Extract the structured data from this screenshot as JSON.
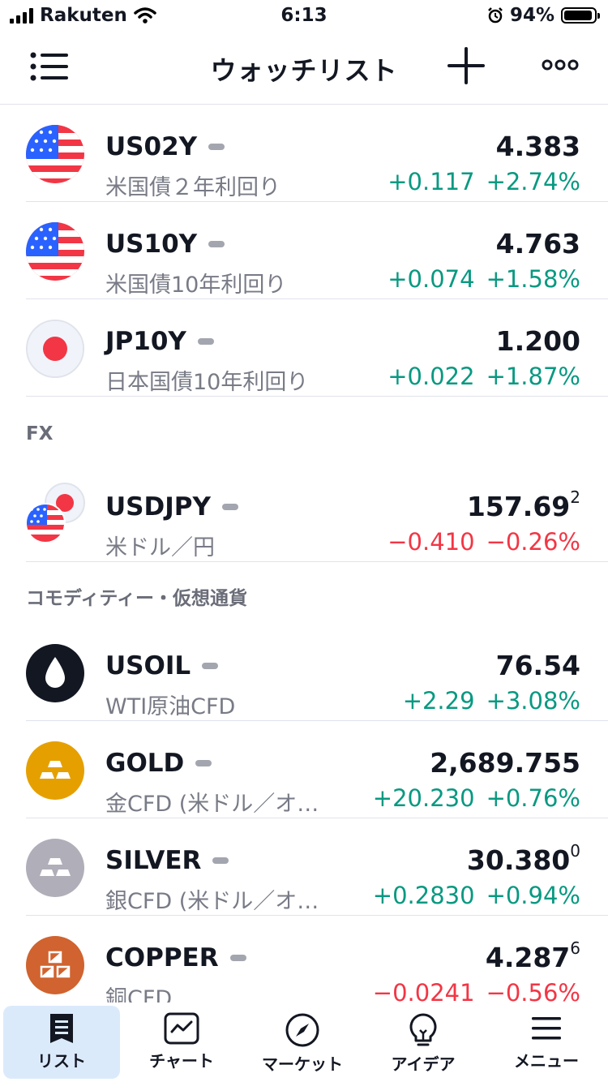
{
  "status_bar": {
    "carrier": "Rakuten",
    "time": "6:13",
    "battery": "94%"
  },
  "header": {
    "title": "ウォッチリスト"
  },
  "sections": {
    "fx": "FX",
    "commodity": "コモディティー・仮想通貨"
  },
  "rows": [
    {
      "symbol": "US02Y",
      "desc": "米国債２年利回り",
      "price": "4.383",
      "price_sup": "",
      "change": "+0.117",
      "change_pct": "+2.74%",
      "dir": "up"
    },
    {
      "symbol": "US10Y",
      "desc": "米国債10年利回り",
      "price": "4.763",
      "price_sup": "",
      "change": "+0.074",
      "change_pct": "+1.58%",
      "dir": "up"
    },
    {
      "symbol": "JP10Y",
      "desc": "日本国債10年利回り",
      "price": "1.200",
      "price_sup": "",
      "change": "+0.022",
      "change_pct": "+1.87%",
      "dir": "up"
    },
    {
      "symbol": "USDJPY",
      "desc": "米ドル／円",
      "price": "157.69",
      "price_sup": "2",
      "change": "−0.410",
      "change_pct": "−0.26%",
      "dir": "down"
    },
    {
      "symbol": "USOIL",
      "desc": "WTI原油CFD",
      "price": "76.54",
      "price_sup": "",
      "change": "+2.29",
      "change_pct": "+3.08%",
      "dir": "up"
    },
    {
      "symbol": "GOLD",
      "desc": "金CFD (米ドル／オ…",
      "price": "2,689.755",
      "price_sup": "",
      "change": "+20.230",
      "change_pct": "+0.76%",
      "dir": "up"
    },
    {
      "symbol": "SILVER",
      "desc": "銀CFD (米ドル／オ…",
      "price": "30.380",
      "price_sup": "0",
      "change": "+0.2830",
      "change_pct": "+0.94%",
      "dir": "up"
    },
    {
      "symbol": "COPPER",
      "desc": "銅CFD",
      "price": "4.287",
      "price_sup": "6",
      "change": "−0.0241",
      "change_pct": "−0.56%",
      "dir": "down"
    }
  ],
  "tabs": [
    {
      "label": "リスト",
      "icon": "list-icon",
      "active": true
    },
    {
      "label": "チャート",
      "icon": "chart-icon",
      "active": false
    },
    {
      "label": "マーケット",
      "icon": "compass-icon",
      "active": false
    },
    {
      "label": "アイデア",
      "icon": "bulb-icon",
      "active": false
    },
    {
      "label": "メニュー",
      "icon": "menu-icon",
      "active": false
    }
  ],
  "colors": {
    "up": "#089981",
    "down": "#f23645",
    "active_tab": "#dbeafb",
    "gold": "#e5a000",
    "silver": "#b0aeb8",
    "copper": "#d0632f"
  }
}
